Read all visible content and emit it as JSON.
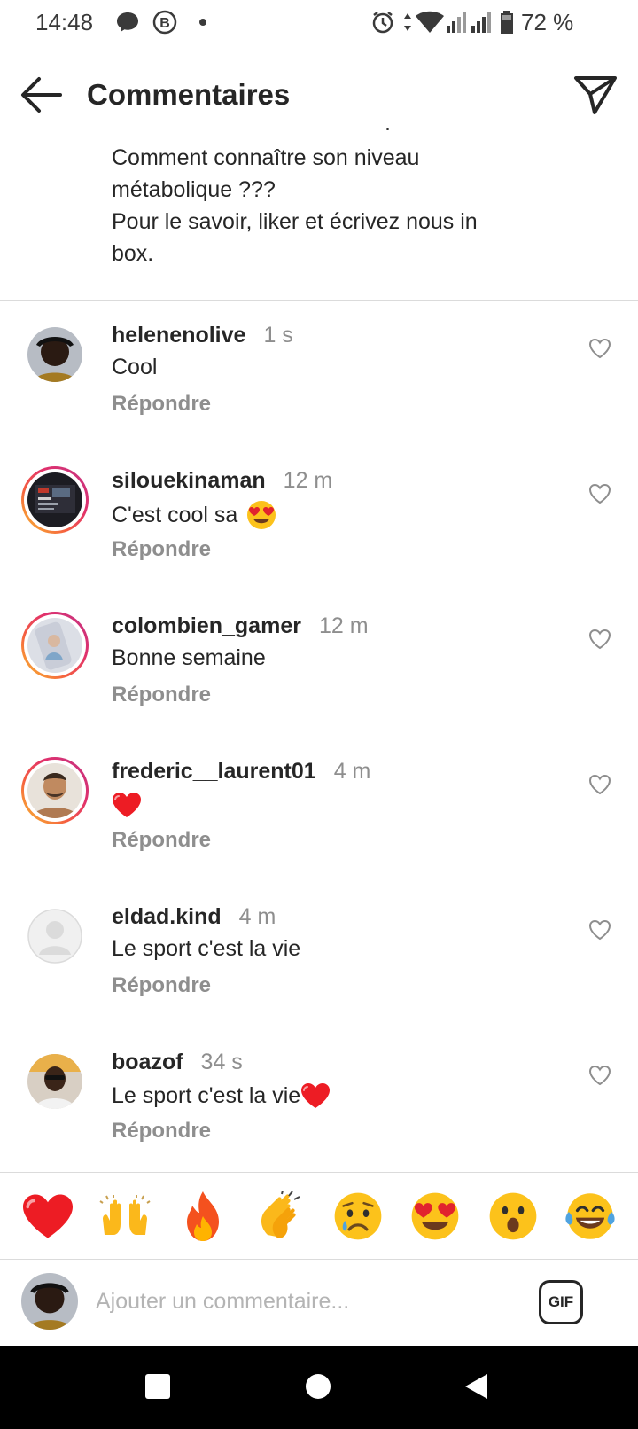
{
  "status_bar": {
    "time": "14:48",
    "battery": "72 %",
    "icons": [
      "message-icon",
      "b-badge-icon",
      "dot-icon",
      "alarm-icon",
      "data-arrows-icon",
      "wifi-icon",
      "signal-icon",
      "signal-icon-2",
      "battery-icon"
    ]
  },
  "header": {
    "title": "Commentaires",
    "back_icon": "arrow-left-icon",
    "share_icon": "paper-plane-icon"
  },
  "caption": {
    "lines": [
      "Comment connaître son niveau",
      "métabolique ???",
      "Pour le savoir, liker et écrivez nous in",
      "box."
    ]
  },
  "comments": [
    {
      "username": "helenenolive",
      "time": "1 s",
      "text": "Cool",
      "emoji": "",
      "reply": "Répondre",
      "story_ring": false
    },
    {
      "username": "silouekinaman",
      "time": "12 m",
      "text": "C'est cool sa",
      "emoji": "heart-eyes",
      "reply": "Répondre",
      "story_ring": true
    },
    {
      "username": "colombien_gamer",
      "time": "12 m",
      "text": "Bonne semaine",
      "emoji": "",
      "reply": "Répondre",
      "story_ring": true
    },
    {
      "username": "frederic__laurent01",
      "time": "4 m",
      "text": "",
      "emoji": "red-heart",
      "reply": "Répondre",
      "story_ring": true
    },
    {
      "username": "eldad.kind",
      "time": "4 m",
      "text": "Le sport c'est la vie",
      "emoji": "",
      "reply": "Répondre",
      "story_ring": false
    },
    {
      "username": "boazof",
      "time": "34 s",
      "text": "Le sport c'est la vie",
      "emoji": "red-heart",
      "reply": "Répondre",
      "story_ring": false
    }
  ],
  "quick_emojis": [
    "red-heart",
    "raising-hands",
    "fire",
    "clapping-hands",
    "sad-tear",
    "heart-eyes",
    "surprised",
    "tears-of-joy"
  ],
  "input": {
    "placeholder": "Ajouter un commentaire...",
    "gif_label": "GIF"
  },
  "colors": {
    "text": "#262626",
    "secondary": "#8e8e8e",
    "divider": "#dbdbdb",
    "heart_red": "#ed1c24"
  }
}
